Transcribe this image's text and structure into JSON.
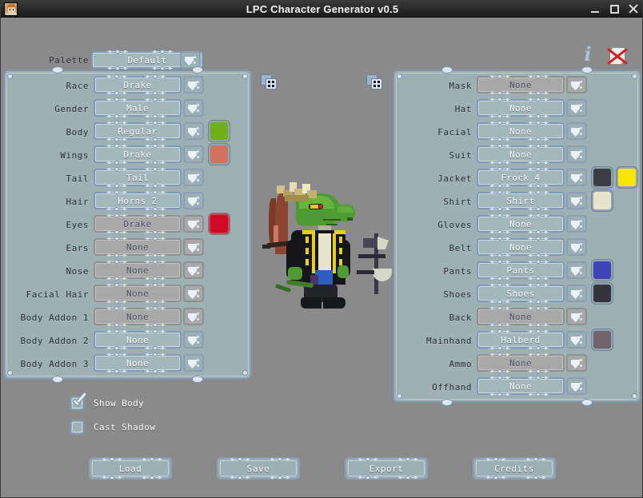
{
  "window": {
    "title": "LPC Character Generator v0.5",
    "icon": "character-portrait-icon",
    "minimize": "minimize-button",
    "maximize": "maximize-button",
    "close": "close-button"
  },
  "toolbar": {
    "palette_label": "Palette",
    "palette_value": "Default",
    "info_icon": "info-icon",
    "no_shadow_icon": "no-background-icon"
  },
  "left_panel": {
    "rows": [
      {
        "label": "Race",
        "value": "Drake",
        "enabled": true,
        "swatch": null
      },
      {
        "label": "Gender",
        "value": "Male",
        "enabled": true,
        "swatch": null
      },
      {
        "label": "Body",
        "value": "Regular",
        "enabled": true,
        "swatch": "#6fb016"
      },
      {
        "label": "Wings",
        "value": "Drake",
        "enabled": true,
        "swatch": "#d3735e"
      },
      {
        "label": "Tail",
        "value": "Tail",
        "enabled": true,
        "swatch": null
      },
      {
        "label": "Hair",
        "value": "Horns 2",
        "enabled": true,
        "swatch": null
      },
      {
        "label": "Eyes",
        "value": "Drake",
        "enabled": false,
        "swatch": "#ce0a26",
        "swatch_border": "#c4485a"
      },
      {
        "label": "Ears",
        "value": "None",
        "enabled": false,
        "swatch": null
      },
      {
        "label": "Nose",
        "value": "None",
        "enabled": false,
        "swatch": null
      },
      {
        "label": "Facial Hair",
        "value": "None",
        "enabled": false,
        "swatch": null
      },
      {
        "label": "Body Addon 1",
        "value": "None",
        "enabled": false,
        "swatch": null
      },
      {
        "label": "Body Addon 2",
        "value": "None",
        "enabled": true,
        "swatch": null
      },
      {
        "label": "Body Addon 3",
        "value": "None",
        "enabled": true,
        "swatch": null
      }
    ]
  },
  "right_panel": {
    "rows": [
      {
        "label": "Mask",
        "value": "None",
        "enabled": false,
        "swatch": null,
        "swatch2": null
      },
      {
        "label": "Hat",
        "value": "None",
        "enabled": true,
        "swatch": null,
        "swatch2": null
      },
      {
        "label": "Facial",
        "value": "None",
        "enabled": true,
        "swatch": null,
        "swatch2": null
      },
      {
        "label": "Suit",
        "value": "None",
        "enabled": true,
        "swatch": null,
        "swatch2": null
      },
      {
        "label": "Jacket",
        "value": "Frock 4",
        "enabled": true,
        "swatch": "#3a3d43",
        "swatch2": "#f7e600"
      },
      {
        "label": "Shirt",
        "value": "Shirt",
        "enabled": true,
        "swatch": "#e8e3cb",
        "swatch2": null
      },
      {
        "label": "Gloves",
        "value": "None",
        "enabled": true,
        "swatch": null,
        "swatch2": null
      },
      {
        "label": "Belt",
        "value": "None",
        "enabled": true,
        "swatch": null,
        "swatch2": null
      },
      {
        "label": "Pants",
        "value": "Pants",
        "enabled": true,
        "swatch": "#3f44b5",
        "swatch2": null
      },
      {
        "label": "Shoes",
        "value": "Shoes",
        "enabled": true,
        "swatch": "#34363c",
        "swatch2": null
      },
      {
        "label": "Back",
        "value": "None",
        "enabled": false,
        "swatch": null,
        "swatch2": null
      },
      {
        "label": "Mainhand",
        "value": "Halberd",
        "enabled": true,
        "swatch": "#6e6369",
        "swatch2": null
      },
      {
        "label": "Ammo",
        "value": "None",
        "enabled": false,
        "swatch": null,
        "swatch2": null
      },
      {
        "label": "Offhand",
        "value": "None",
        "enabled": true,
        "swatch": null,
        "swatch2": null
      }
    ]
  },
  "canvas": {
    "randomize_left_icon": "dice-icon",
    "randomize_right_icon": "dice-icon",
    "preview": "character-sprite-preview"
  },
  "options": {
    "show_body": {
      "label": "Show Body",
      "checked": true
    },
    "cast_shadow": {
      "label": "Cast Shadow",
      "checked": false
    }
  },
  "buttons": [
    {
      "label": "Load"
    },
    {
      "label": "Save"
    },
    {
      "label": "Export"
    },
    {
      "label": "Credits"
    }
  ],
  "colors": {
    "app_background": "#8a8a8a",
    "panel_background": "#9db0b3",
    "panel_border": "#7e95ab",
    "titlebar": "#2c2c2c",
    "control_enabled": "#a3b8bd",
    "control_disabled": "#a8a8a8"
  }
}
